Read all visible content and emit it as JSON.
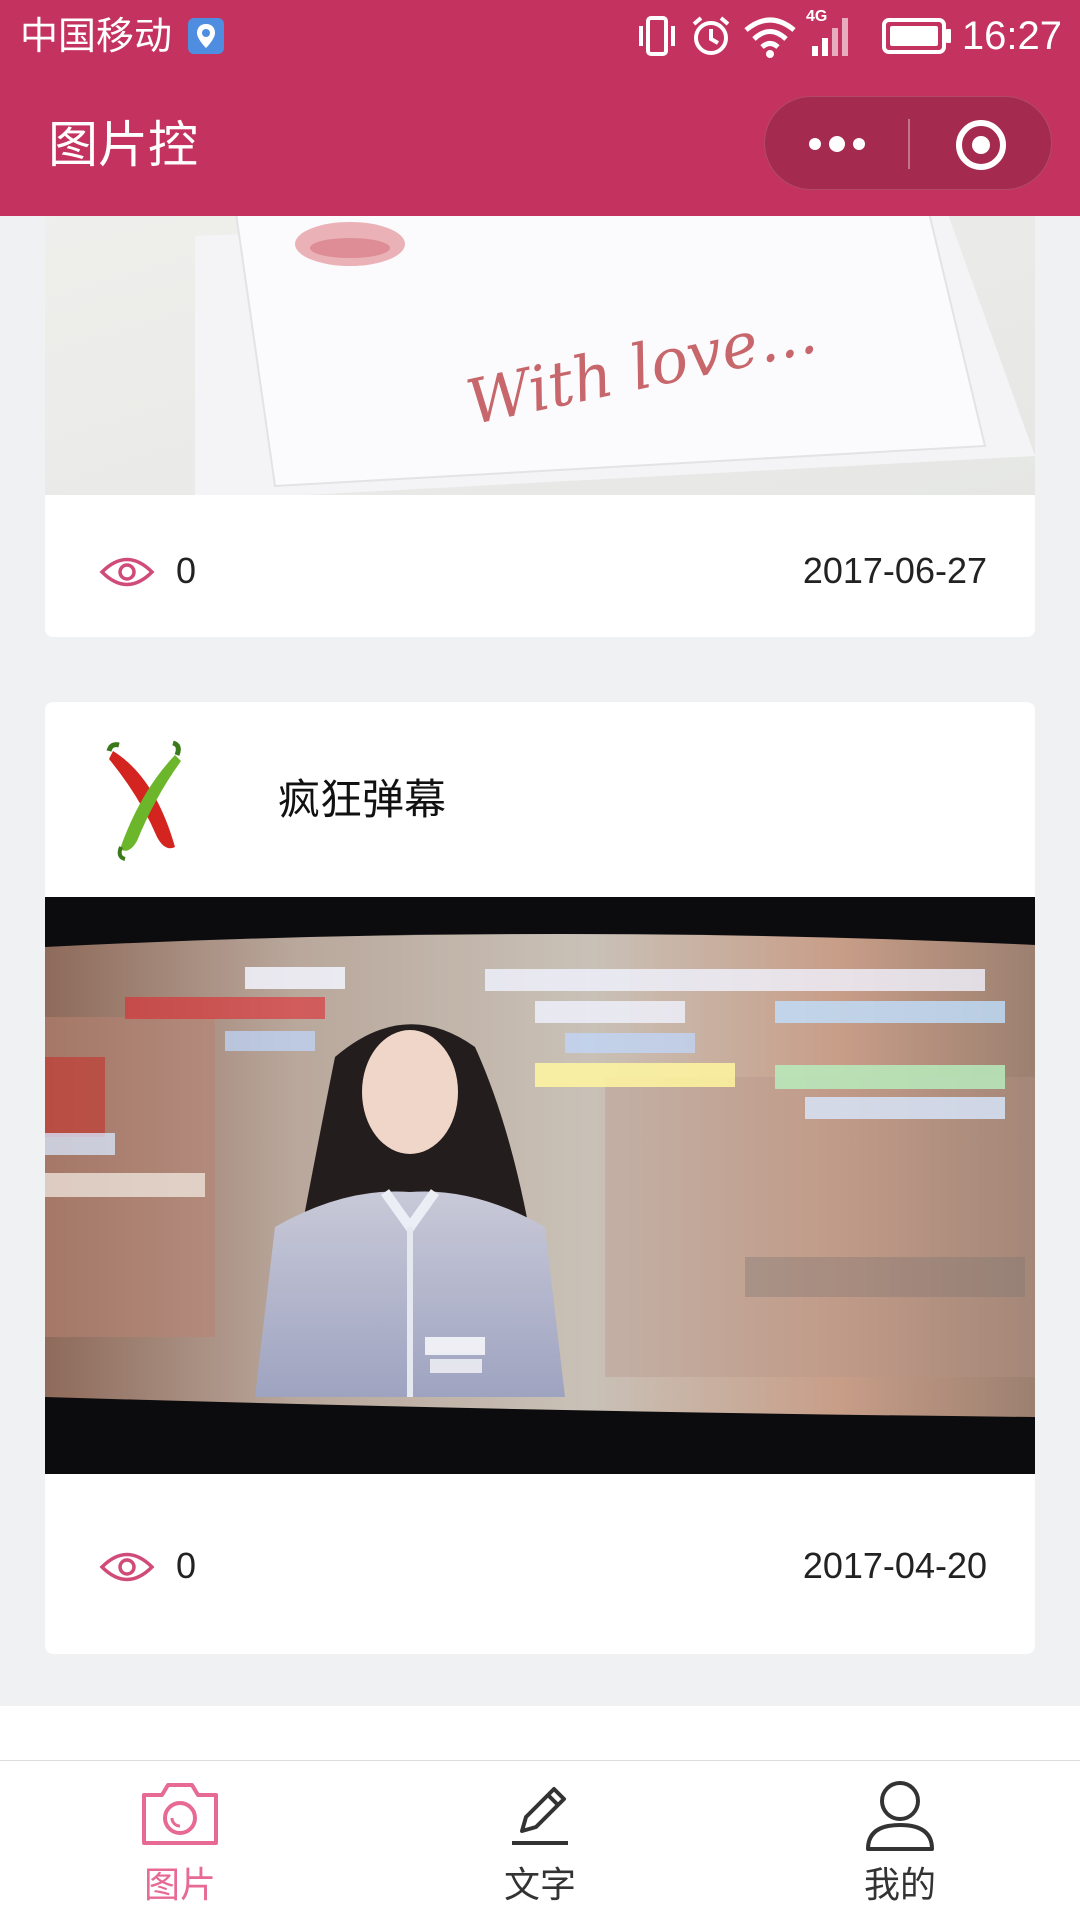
{
  "status_bar": {
    "carrier": "中国移动",
    "network": "4G",
    "time": "16:27"
  },
  "nav": {
    "title": "图片控"
  },
  "posts": [
    {
      "image_caption": "With love...",
      "views": "0",
      "date": "2017-06-27"
    },
    {
      "title": "疯狂弹幕",
      "views": "0",
      "date": "2017-04-20"
    }
  ],
  "tabs": [
    {
      "label": "图片",
      "icon": "camera-icon",
      "active": true
    },
    {
      "label": "文字",
      "icon": "pencil-icon",
      "active": false
    },
    {
      "label": "我的",
      "icon": "person-icon",
      "active": false
    }
  ],
  "colors": {
    "brand": "#c4325f",
    "active_tab": "#e76a94"
  }
}
